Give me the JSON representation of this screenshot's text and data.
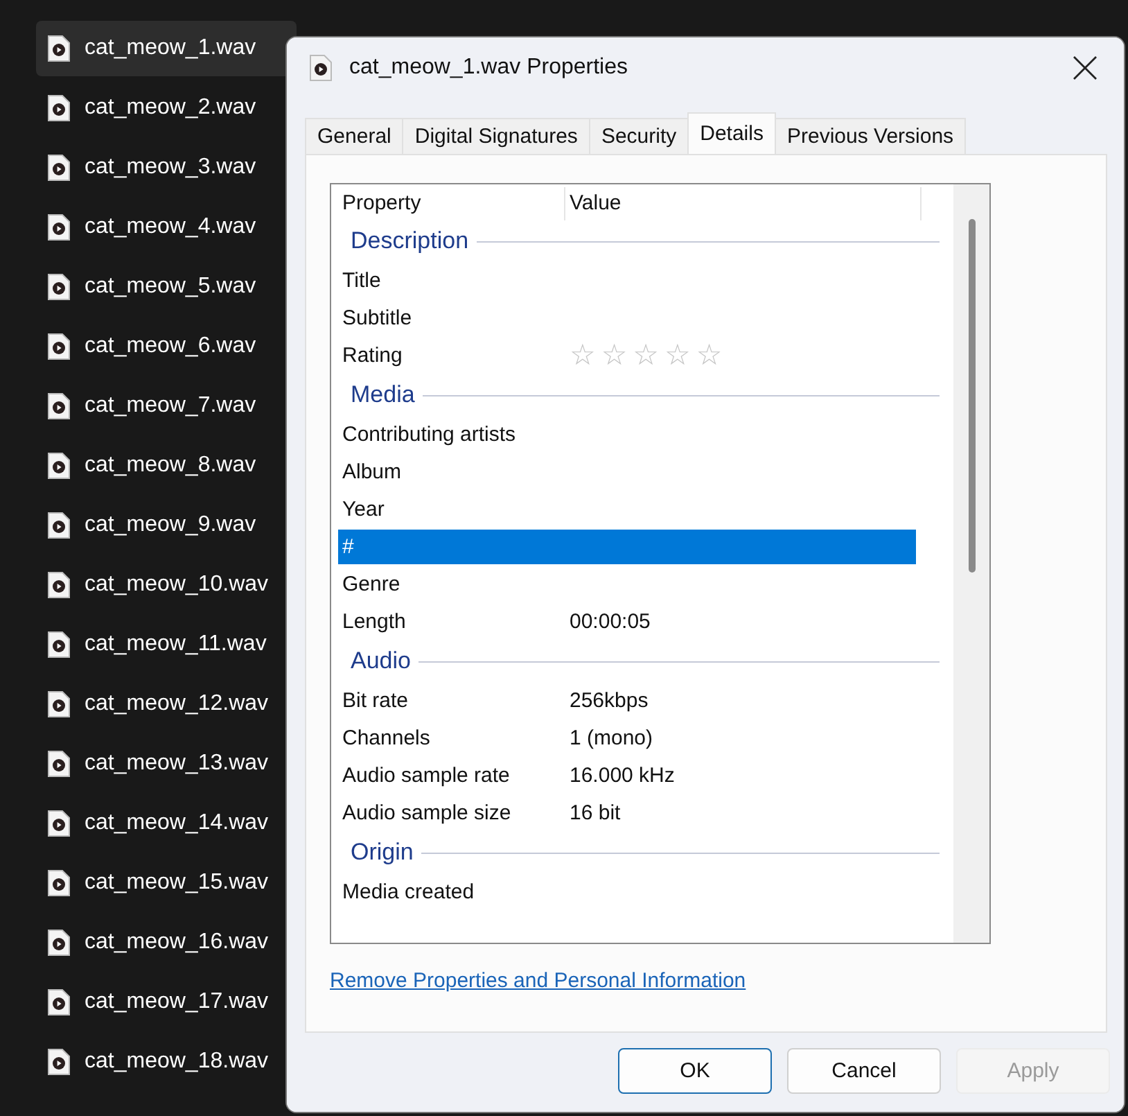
{
  "files": [
    {
      "name": "cat_meow_1.wav",
      "selected": true
    },
    {
      "name": "cat_meow_2.wav",
      "selected": false
    },
    {
      "name": "cat_meow_3.wav",
      "selected": false
    },
    {
      "name": "cat_meow_4.wav",
      "selected": false
    },
    {
      "name": "cat_meow_5.wav",
      "selected": false
    },
    {
      "name": "cat_meow_6.wav",
      "selected": false
    },
    {
      "name": "cat_meow_7.wav",
      "selected": false
    },
    {
      "name": "cat_meow_8.wav",
      "selected": false
    },
    {
      "name": "cat_meow_9.wav",
      "selected": false
    },
    {
      "name": "cat_meow_10.wav",
      "selected": false
    },
    {
      "name": "cat_meow_11.wav",
      "selected": false
    },
    {
      "name": "cat_meow_12.wav",
      "selected": false
    },
    {
      "name": "cat_meow_13.wav",
      "selected": false
    },
    {
      "name": "cat_meow_14.wav",
      "selected": false
    },
    {
      "name": "cat_meow_15.wav",
      "selected": false
    },
    {
      "name": "cat_meow_16.wav",
      "selected": false
    },
    {
      "name": "cat_meow_17.wav",
      "selected": false
    },
    {
      "name": "cat_meow_18.wav",
      "selected": false
    }
  ],
  "dialog": {
    "title": "cat_meow_1.wav Properties",
    "tabs": [
      {
        "label": "General",
        "selected": false
      },
      {
        "label": "Digital Signatures",
        "selected": false
      },
      {
        "label": "Security",
        "selected": false
      },
      {
        "label": "Details",
        "selected": true
      },
      {
        "label": "Previous Versions",
        "selected": false
      }
    ],
    "columns": [
      "Property",
      "Value"
    ],
    "rows": [
      {
        "kind": "section",
        "label": "Description"
      },
      {
        "kind": "field",
        "label": "Title",
        "selected": false
      },
      {
        "kind": "field",
        "label": "Subtitle",
        "selected": false
      },
      {
        "kind": "rating",
        "label": "Rating",
        "stars": 0,
        "selected": false
      },
      {
        "kind": "section",
        "label": "Media"
      },
      {
        "kind": "field",
        "label": "Contributing artists",
        "selected": false
      },
      {
        "kind": "field",
        "label": "Album",
        "selected": false
      },
      {
        "kind": "field",
        "label": "Year",
        "selected": false
      },
      {
        "kind": "field",
        "label": "#",
        "selected": true
      },
      {
        "kind": "field",
        "label": "Genre",
        "selected": false
      },
      {
        "kind": "field",
        "label": "Length",
        "value": "00:00:05",
        "selected": false
      },
      {
        "kind": "section",
        "label": "Audio"
      },
      {
        "kind": "field",
        "label": "Bit rate",
        "value": "256kbps",
        "selected": false
      },
      {
        "kind": "field",
        "label": "Channels",
        "value": "1 (mono)",
        "selected": false
      },
      {
        "kind": "field",
        "label": "Audio sample rate",
        "value": "16.000 kHz",
        "selected": false
      },
      {
        "kind": "field",
        "label": "Audio sample size",
        "value": "16 bit",
        "selected": false
      },
      {
        "kind": "section",
        "label": "Origin"
      },
      {
        "kind": "field",
        "label": "Media created",
        "selected": false
      }
    ],
    "link": "Remove Properties and Personal Information",
    "buttons": [
      {
        "label": "OK",
        "kind": "default",
        "disabled": false
      },
      {
        "label": "Cancel",
        "kind": "normal",
        "disabled": false
      },
      {
        "label": "Apply",
        "kind": "normal",
        "disabled": true
      }
    ]
  }
}
